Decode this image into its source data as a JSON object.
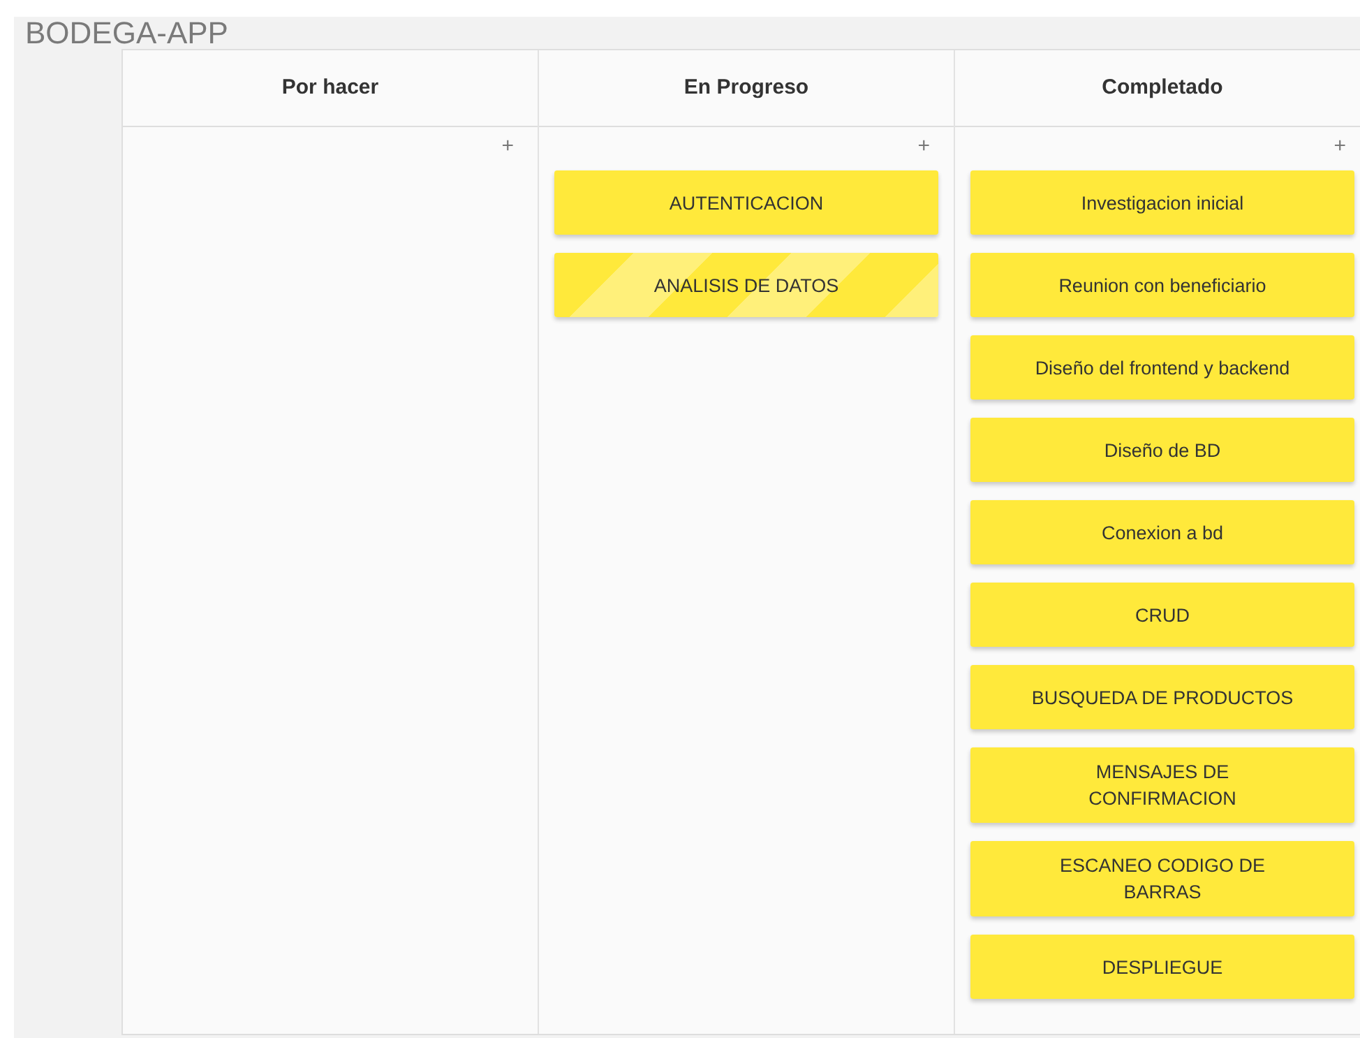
{
  "title": "BODEGA-APP",
  "columns": [
    {
      "name": "Por hacer",
      "add": "+"
    },
    {
      "name": "En Progreso",
      "add": "+",
      "cards": [
        {
          "text": "AUTENTICACION",
          "striped": false
        },
        {
          "text": "ANALISIS DE DATOS",
          "striped": true
        }
      ]
    },
    {
      "name": "Completado",
      "add": "+",
      "cards": [
        {
          "text": "Investigacion inicial",
          "striped": false
        },
        {
          "text": "Reunion con beneficiario",
          "striped": false
        },
        {
          "text": "Diseño del frontend y backend",
          "striped": false
        },
        {
          "text": "Diseño de BD",
          "striped": false
        },
        {
          "text": "Conexion a bd",
          "striped": false
        },
        {
          "text": "CRUD",
          "striped": false
        },
        {
          "text": "BUSQUEDA DE PRODUCTOS",
          "striped": false
        },
        {
          "text": "MENSAJES DE CONFIRMACION",
          "striped": false
        },
        {
          "text": "ESCANEO CODIGO DE BARRAS",
          "striped": false
        },
        {
          "text": "DESPLIEGUE",
          "striped": false
        }
      ]
    }
  ]
}
